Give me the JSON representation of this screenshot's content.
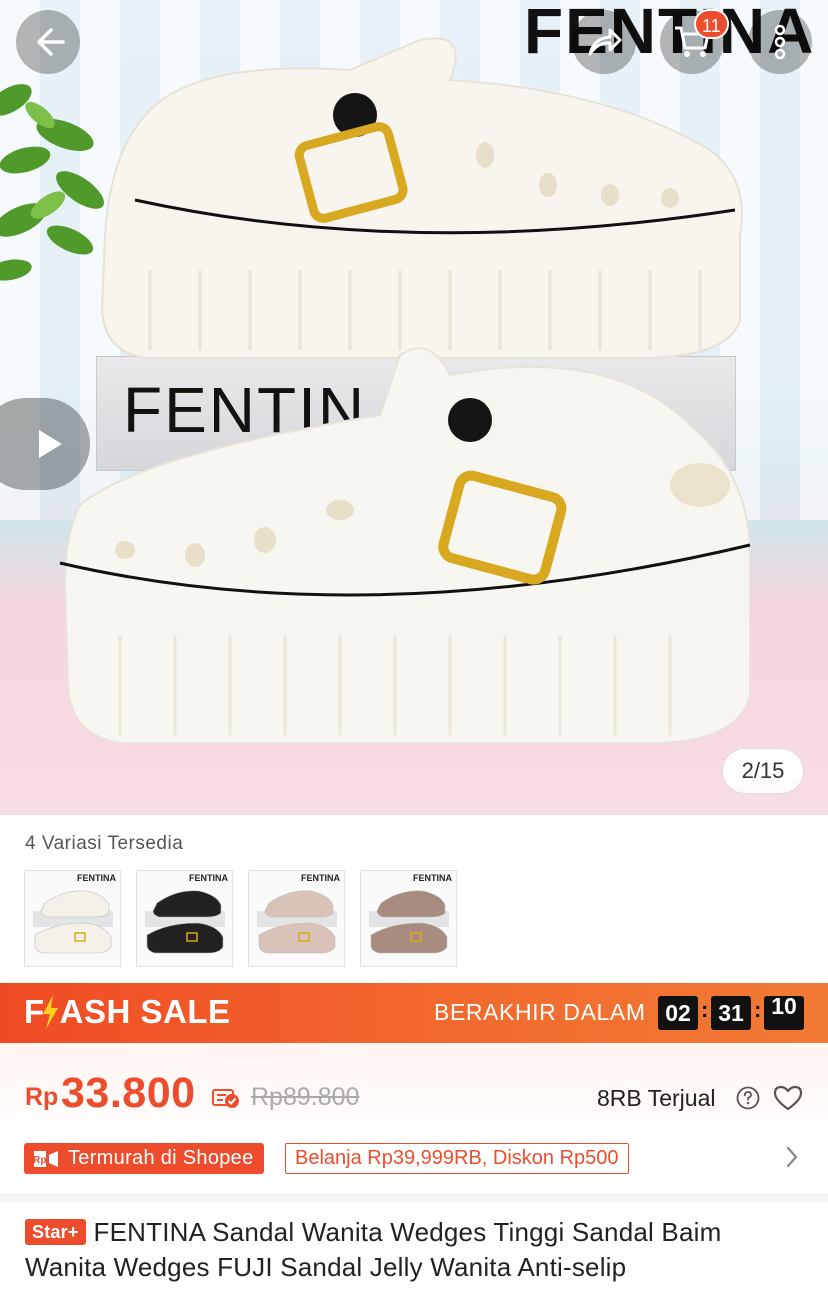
{
  "hero": {
    "brand_watermark": "FENTINA",
    "box_label": "FENTIN",
    "cart_badge_count": "11",
    "image_counter": "2/15"
  },
  "icons": {
    "back": "back-arrow-icon",
    "share": "share-icon",
    "cart": "cart-icon",
    "more": "more-vertical-icon",
    "play": "play-icon"
  },
  "variants": {
    "label": "4 Variasi Tersedia",
    "items": [
      {
        "brand": "FENTINA",
        "color": "#f4f1ea"
      },
      {
        "brand": "FENTINA",
        "color": "#222222"
      },
      {
        "brand": "FENTINA",
        "color": "#d9c3b8"
      },
      {
        "brand": "FENTINA",
        "color": "#a88c80"
      }
    ]
  },
  "flash_sale": {
    "logo_lead": "F",
    "logo_rest": "ASH SALE",
    "ends_label": "BERAKHIR DALAM",
    "hours": "02",
    "minutes": "31",
    "seconds": "10"
  },
  "price": {
    "currency": "Rp",
    "current": "33.800",
    "original": "Rp89.800",
    "sold": "8RB Terjual",
    "tag_cheapest": "Termurah di Shopee",
    "tag_discount": "Belanja Rp39,999RB, Diskon Rp500"
  },
  "product": {
    "badge": "Star+",
    "title": "FENTINA Sandal Wanita Wedges Tinggi Sandal Baim Wanita Wedges FUJI Sandal Jelly Wanita Anti-selip"
  },
  "colors": {
    "accent": "#ee4d2d"
  }
}
